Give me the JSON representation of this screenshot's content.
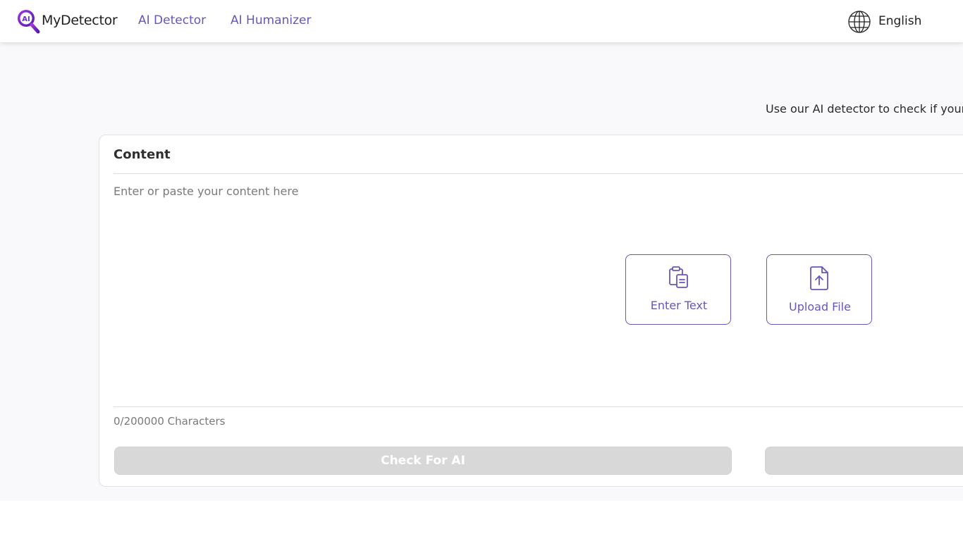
{
  "header": {
    "brand": "MyDetector",
    "logo_text": "AI",
    "nav": [
      "AI Detector",
      "AI Humanizer"
    ],
    "language": "English"
  },
  "intro": {
    "text": "Use our AI detector to check if your te"
  },
  "content_card": {
    "title": "Content",
    "placeholder": "Enter or paste your content here",
    "options": [
      {
        "label": "Enter Text",
        "icon": "clipboard-icon"
      },
      {
        "label": "Upload File",
        "icon": "file-upload-icon"
      }
    ],
    "char_count": "0/200000 Characters",
    "check_button": "Check For AI"
  },
  "colors": {
    "accent": "#6a55b8",
    "logo_gradient_start": "#9b2fd6",
    "logo_gradient_end": "#5a1fb5",
    "page_bg": "#f9f8fa",
    "disabled_button": "#d8d8d8"
  }
}
